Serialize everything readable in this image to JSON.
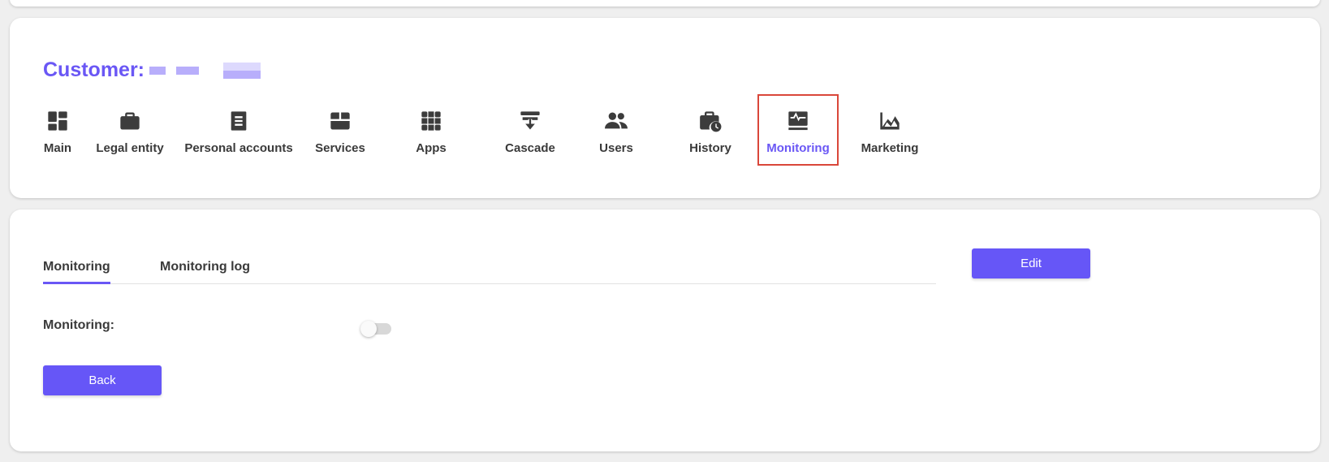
{
  "customer": {
    "title_prefix": "Customer:"
  },
  "nav": {
    "items": [
      {
        "id": "main",
        "label": "Main",
        "icon": "dashboard-icon"
      },
      {
        "id": "legal-entity",
        "label": "Legal entity",
        "icon": "briefcase-icon"
      },
      {
        "id": "personal-accounts",
        "label": "Personal accounts",
        "icon": "document-icon"
      },
      {
        "id": "services",
        "label": "Services",
        "icon": "box-icon"
      },
      {
        "id": "apps",
        "label": "Apps",
        "icon": "grid-icon"
      },
      {
        "id": "cascade",
        "label": "Cascade",
        "icon": "cascade-icon"
      },
      {
        "id": "users",
        "label": "Users",
        "icon": "users-icon"
      },
      {
        "id": "history",
        "label": "History",
        "icon": "briefcase-clock-icon"
      },
      {
        "id": "monitoring",
        "label": "Monitoring",
        "icon": "monitor-pulse-icon",
        "active": true
      },
      {
        "id": "marketing",
        "label": "Marketing",
        "icon": "chart-area-icon"
      }
    ]
  },
  "tabs": [
    {
      "label": "Monitoring",
      "active": true
    },
    {
      "label": "Monitoring log",
      "active": false
    }
  ],
  "form": {
    "monitoring_label": "Monitoring:",
    "monitoring_enabled": false
  },
  "buttons": {
    "edit_label": "Edit",
    "back_label": "Back"
  },
  "colors": {
    "accent": "#6a57f5",
    "button": "#6656f7",
    "highlight_border": "#d9473a"
  }
}
